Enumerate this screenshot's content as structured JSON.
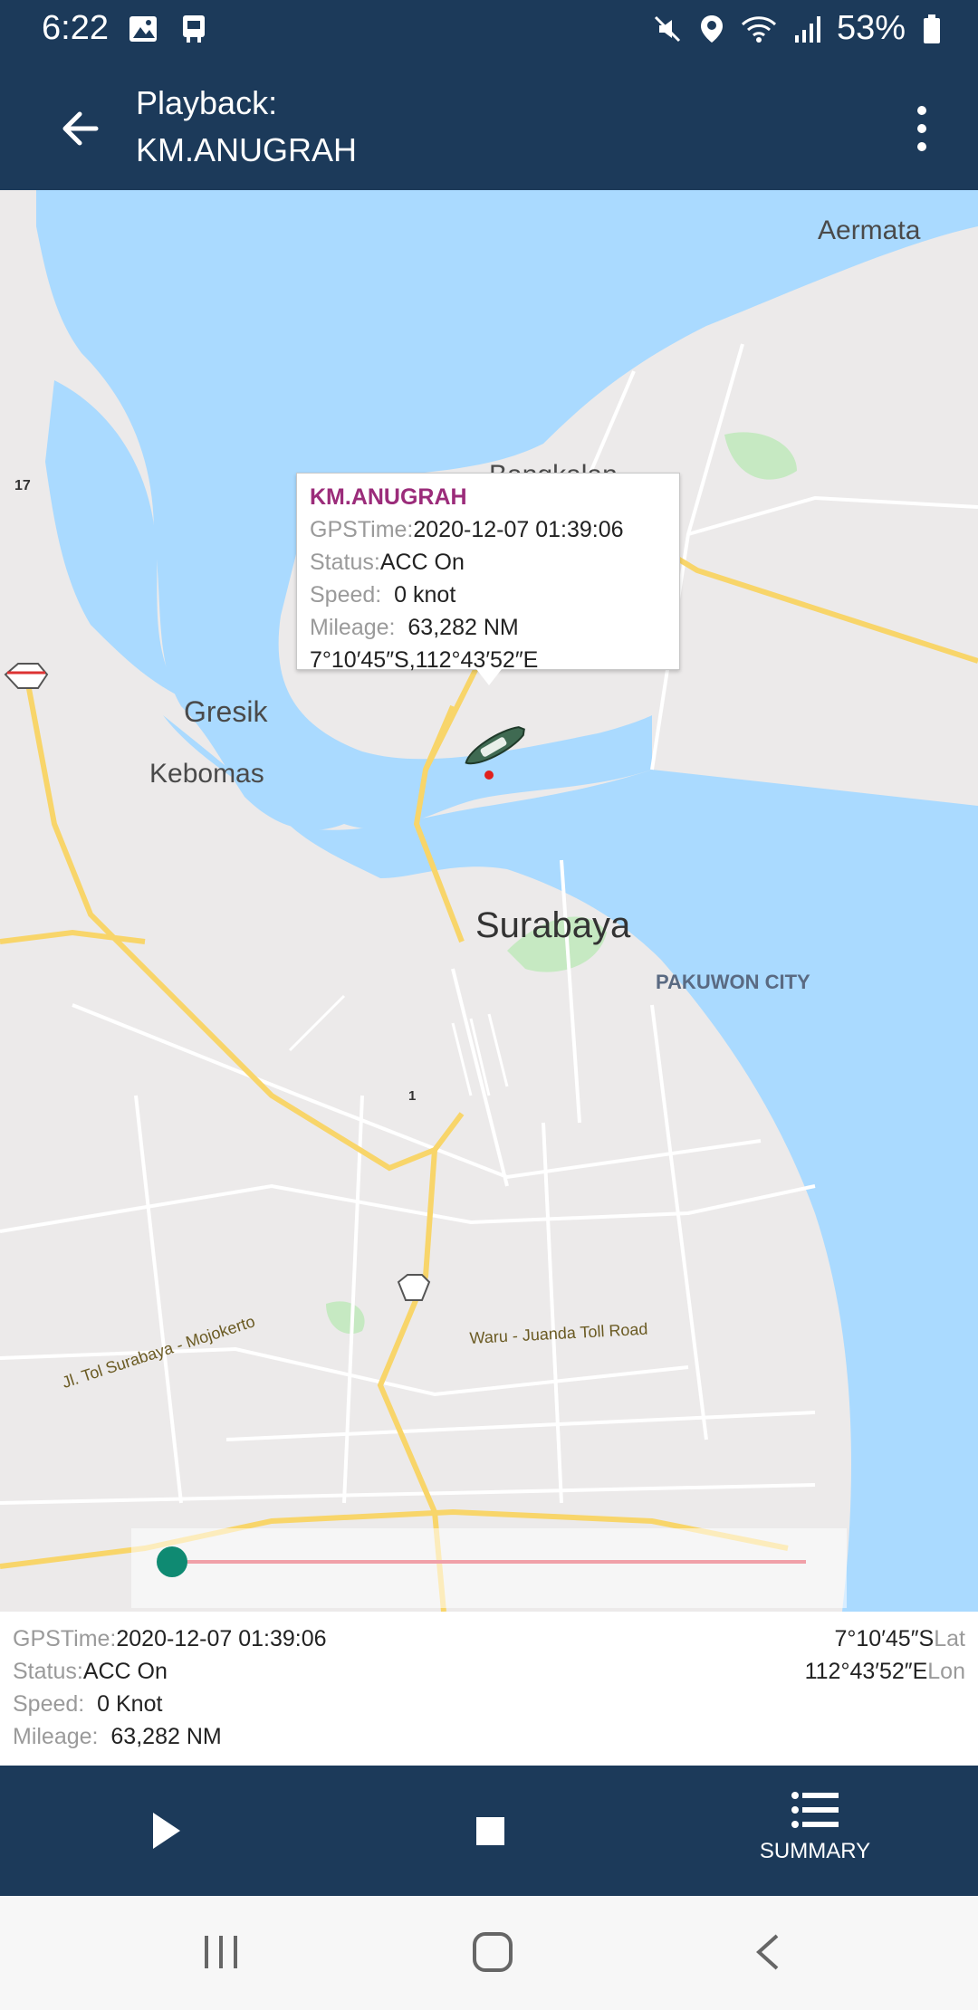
{
  "status_bar": {
    "time": "6:22",
    "battery": "53%"
  },
  "app_bar": {
    "title_line1": "Playback:",
    "title_line2": "KM.ANUGRAH"
  },
  "map": {
    "labels": {
      "aermata": "Aermata",
      "bangkalan": "Bangkalan",
      "gresik": "Gresik",
      "kebomas": "Kebomas",
      "surabaya": "Surabaya",
      "pakuwon": "PAKUWON CITY",
      "road_17": "17",
      "road_1": "1",
      "toll_a": "Jl. Tol Surabaya - Mojokerto",
      "toll_b": "Waru - Juanda Toll Road"
    },
    "colors": {
      "water": "#aadaff",
      "land": "#eceaea",
      "park": "#c6e9c2",
      "highway": "#f8d56a"
    }
  },
  "popup": {
    "name": "KM.ANUGRAH",
    "gps_key": "GPSTime:",
    "gps_val": "2020-12-07 01:39:06",
    "status_key": "Status:",
    "status_val": "ACC On",
    "speed_key": "Speed:",
    "speed_val": "0 knot",
    "mileage_key": "Mileage:",
    "mileage_val": "63,282 NM",
    "coords": "7°10′45″S,112°43′52″E"
  },
  "playback": {
    "progress": 0.0
  },
  "info": {
    "gps_key": "GPSTime:",
    "gps_val": "2020-12-07 01:39:06",
    "status_key": "Status:",
    "status_val": "ACC On",
    "speed_key": "Speed:",
    "speed_val": "0 Knot",
    "mileage_key": "Mileage:",
    "mileage_val": "63,282 NM",
    "lat_val": "7°10′45″S",
    "lat_key": "Lat",
    "lon_val": "112°43′52″E",
    "lon_key": "Lon"
  },
  "controls": {
    "summary_label": "SUMMARY"
  },
  "icons": {
    "back": "back-arrow-icon",
    "menu": "more-vert-icon",
    "play": "play-icon",
    "stop": "stop-icon",
    "summary": "list-icon",
    "ship": "ship-icon"
  }
}
